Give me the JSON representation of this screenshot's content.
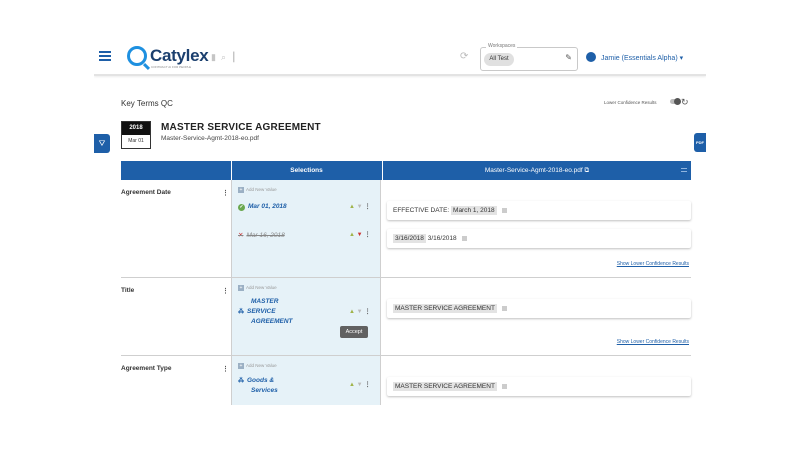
{
  "header": {
    "logo_text": "Catylex",
    "logo_sub": "CONTRACT AI FOR PEOPLE",
    "workspace_legend": "Workspaces",
    "workspace_value": "All Test",
    "user_name": "Jamie (Essentials Alpha) ▾"
  },
  "page": {
    "title": "Key Terms QC",
    "toggle_label": "Lower Confidence Results",
    "cal_year": "2018",
    "cal_date": "Mar 01",
    "doc_title": "MASTER SERVICE AGREEMENT",
    "doc_file": "Master-Service-Agmt-2018-eo.pdf",
    "pdf_tab": "PDF"
  },
  "table": {
    "col_selections": "Selections",
    "col_file": "Master-Service-Agmt-2018-eo.pdf ⧉",
    "add_new": "Add New Value",
    "show_lower": "Show Lower Confidence Results",
    "rows": [
      {
        "label": "Agreement Date",
        "sel1": "Mar 01, 2018",
        "sel2": "Mar 16, 2018",
        "snip1_prefix": "EFFECTIVE DATE:",
        "snip1_hl": "March 1, 2018",
        "snip2_hl": "3/16/2018",
        "snip2_suffix": "3/16/2018"
      },
      {
        "label": "Title",
        "sel1_line1": "MASTER",
        "sel1_line2": "SERVICE",
        "sel1_line3": "AGREEMENT",
        "snip1_hl": "MASTER SERVICE AGREEMENT"
      },
      {
        "label": "Agreement Type",
        "sel1_line1": "Goods &",
        "sel1_line2": "Services",
        "snip1_hl": "MASTER SERVICE AGREEMENT"
      }
    ]
  },
  "tooltip": "Accept"
}
